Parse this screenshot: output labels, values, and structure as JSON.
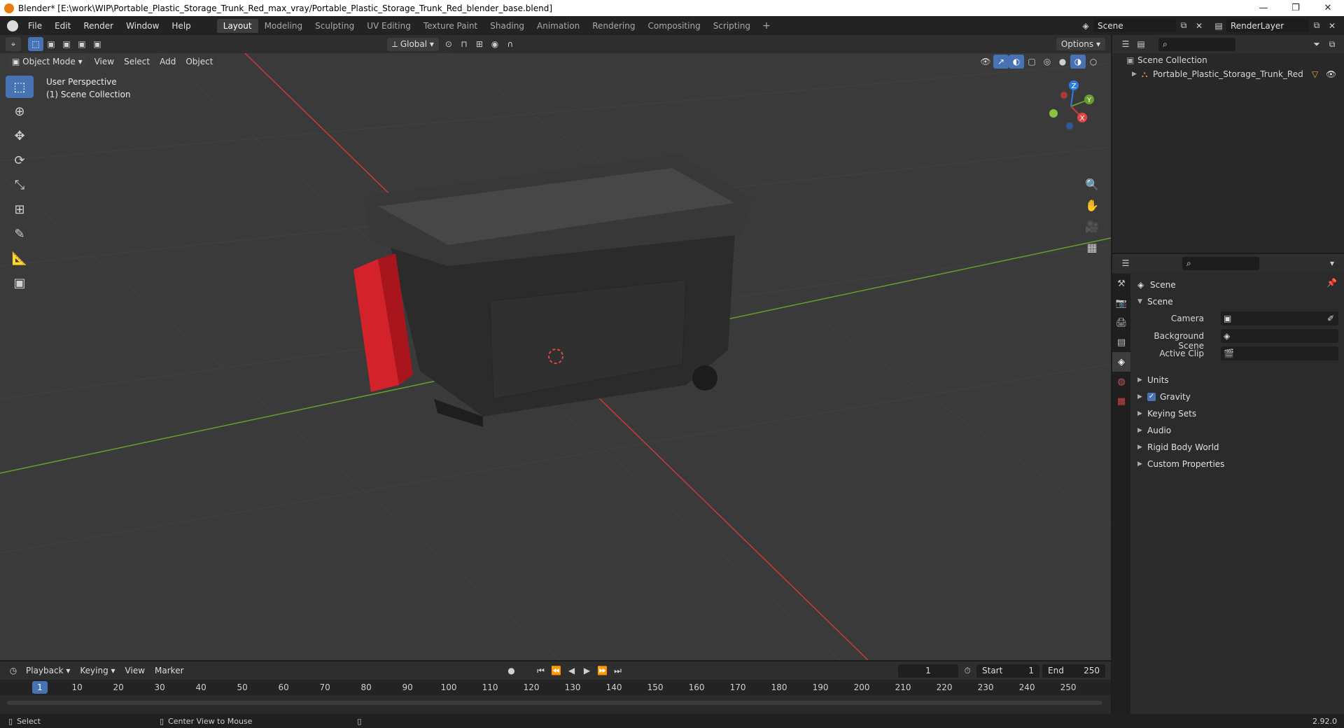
{
  "window": {
    "title": "Blender* [E:\\work\\WIP\\Portable_Plastic_Storage_Trunk_Red_max_vray/Portable_Plastic_Storage_Trunk_Red_blender_base.blend]"
  },
  "menu": [
    "File",
    "Edit",
    "Render",
    "Window",
    "Help"
  ],
  "workspaces": [
    "Layout",
    "Modeling",
    "Sculpting",
    "UV Editing",
    "Texture Paint",
    "Shading",
    "Animation",
    "Rendering",
    "Compositing",
    "Scripting"
  ],
  "active_workspace": "Layout",
  "scene_selector": {
    "scene": "Scene",
    "render_layer": "RenderLayer"
  },
  "viewport": {
    "mode": "Object Mode",
    "menus": [
      "View",
      "Select",
      "Add",
      "Object"
    ],
    "transform_orientation": "Global",
    "options_label": "Options",
    "overlay_line1": "User Perspective",
    "overlay_line2": "(1) Scene Collection",
    "gizmo_axes": {
      "x": "X",
      "y": "Y",
      "z": "Z"
    },
    "colors": {
      "x_axis": "#c83a3a",
      "y_axis": "#6a9e2a",
      "z_axis": "#2c7de0",
      "accent": "#4772b3"
    }
  },
  "outliner": {
    "root": "Scene Collection",
    "items": [
      {
        "name": "Portable_Plastic_Storage_Trunk_Red"
      }
    ]
  },
  "properties": {
    "breadcrumb": "Scene",
    "panel_title": "Scene",
    "fields": [
      {
        "label": "Camera",
        "value": ""
      },
      {
        "label": "Background Scene",
        "value": ""
      },
      {
        "label": "Active Clip",
        "value": ""
      }
    ],
    "sections": [
      "Units",
      "Gravity",
      "Keying Sets",
      "Audio",
      "Rigid Body World",
      "Custom Properties"
    ],
    "gravity_enabled": true
  },
  "timeline": {
    "menus": [
      "Playback",
      "Keying",
      "View",
      "Marker"
    ],
    "current_frame": "1",
    "start_label": "Start",
    "start_value": "1",
    "end_label": "End",
    "end_value": "250",
    "ruler_ticks": [
      "1",
      "10",
      "20",
      "30",
      "40",
      "50",
      "60",
      "70",
      "80",
      "90",
      "100",
      "110",
      "120",
      "130",
      "140",
      "150",
      "160",
      "170",
      "180",
      "190",
      "200",
      "210",
      "220",
      "230",
      "240",
      "250"
    ]
  },
  "statusbar": {
    "left_action": "Select",
    "middle_action": "Center View to Mouse",
    "version": "2.92.0"
  }
}
